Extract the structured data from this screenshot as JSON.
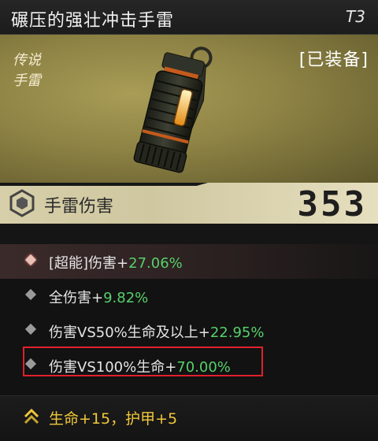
{
  "header": {
    "title": "碾压的强壮冲击手雷",
    "tier": "T3"
  },
  "item": {
    "rarity": "传说",
    "type": "手雷",
    "status": "[已装备]"
  },
  "stat": {
    "name": "手雷伤害",
    "value": "353"
  },
  "attributes": [
    {
      "label": "[超能]伤害+",
      "value": "27.06%"
    },
    {
      "label": "全伤害+",
      "value": "9.82%"
    },
    {
      "label": "伤害VS50%生命及以上+",
      "value": "22.95%"
    },
    {
      "label": "伤害VS100%生命+",
      "value": "70.00%"
    }
  ],
  "bonus": {
    "text": "生命+15，护甲+5"
  },
  "colors": {
    "accent_gold": "#f0c73a",
    "value_green": "#56d06a",
    "highlight_red": "#e0212b"
  },
  "icons": {
    "stat": "hexagon-icon",
    "bonus": "double-chevron-up-icon",
    "rarity_bullet": "diamond-icon"
  }
}
